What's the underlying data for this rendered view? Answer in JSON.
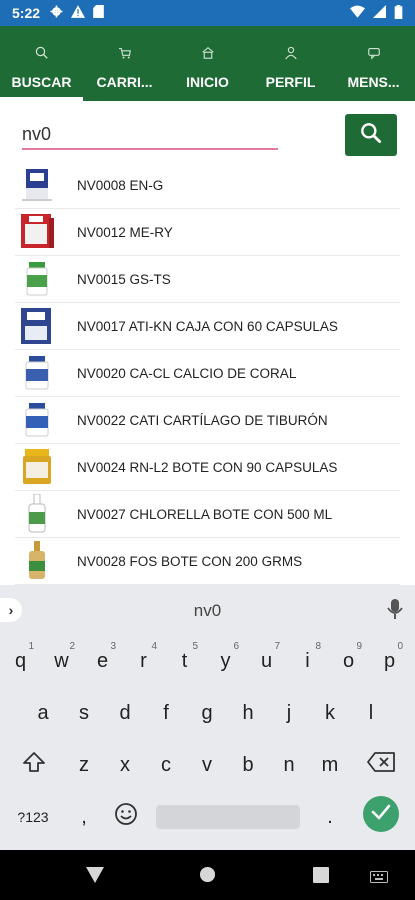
{
  "status_bar": {
    "time": "5:22",
    "icons_left": [
      "gear-icon",
      "warning-icon",
      "sd-card-icon"
    ],
    "icons_right": [
      "wifi-icon",
      "signal-icon",
      "battery-icon"
    ]
  },
  "nav": {
    "tabs": [
      {
        "label": "BUSCAR",
        "icon": "search-icon",
        "active": true
      },
      {
        "label": "CARRI...",
        "icon": "cart-icon",
        "active": false
      },
      {
        "label": "INICIO",
        "icon": "home-icon",
        "active": false
      },
      {
        "label": "PERFIL",
        "icon": "person-icon",
        "active": false
      },
      {
        "label": "MENS...",
        "icon": "message-icon",
        "active": false
      }
    ]
  },
  "search": {
    "value": "nv0",
    "button_icon": "search-icon"
  },
  "results": [
    {
      "label": "NV0008 EN-G"
    },
    {
      "label": "NV0012 ME-RY"
    },
    {
      "label": "NV0015 GS-TS"
    },
    {
      "label": "NV0017 ATI-KN CAJA CON 60 CAPSULAS"
    },
    {
      "label": "NV0020 CA-CL CALCIO DE CORAL"
    },
    {
      "label": "NV0022 CATI CARTÍLAGO DE TIBURÓN"
    },
    {
      "label": "NV0024 RN-L2 BOTE CON 90 CAPSULAS"
    },
    {
      "label": "NV0027 CHLORELLA BOTE CON 500 ML"
    },
    {
      "label": "NV0028 FOS BOTE CON 200 GRMS"
    }
  ],
  "keyboard": {
    "suggestion": "nv0",
    "row1": [
      {
        "k": "q",
        "h": "1"
      },
      {
        "k": "w",
        "h": "2"
      },
      {
        "k": "e",
        "h": "3"
      },
      {
        "k": "r",
        "h": "4"
      },
      {
        "k": "t",
        "h": "5"
      },
      {
        "k": "y",
        "h": "6"
      },
      {
        "k": "u",
        "h": "7"
      },
      {
        "k": "i",
        "h": "8"
      },
      {
        "k": "o",
        "h": "9"
      },
      {
        "k": "p",
        "h": "0"
      }
    ],
    "row2": [
      "a",
      "s",
      "d",
      "f",
      "g",
      "h",
      "j",
      "k",
      "l"
    ],
    "row3": [
      "z",
      "x",
      "c",
      "v",
      "b",
      "n",
      "m"
    ],
    "symbols_key": "?123",
    "comma_key": ",",
    "period_key": "."
  },
  "colors": {
    "status_bar": "#1e6db7",
    "nav_bar": "#1f6b36",
    "search_underline": "#e27aa0",
    "enter_key": "#3ca16d"
  }
}
